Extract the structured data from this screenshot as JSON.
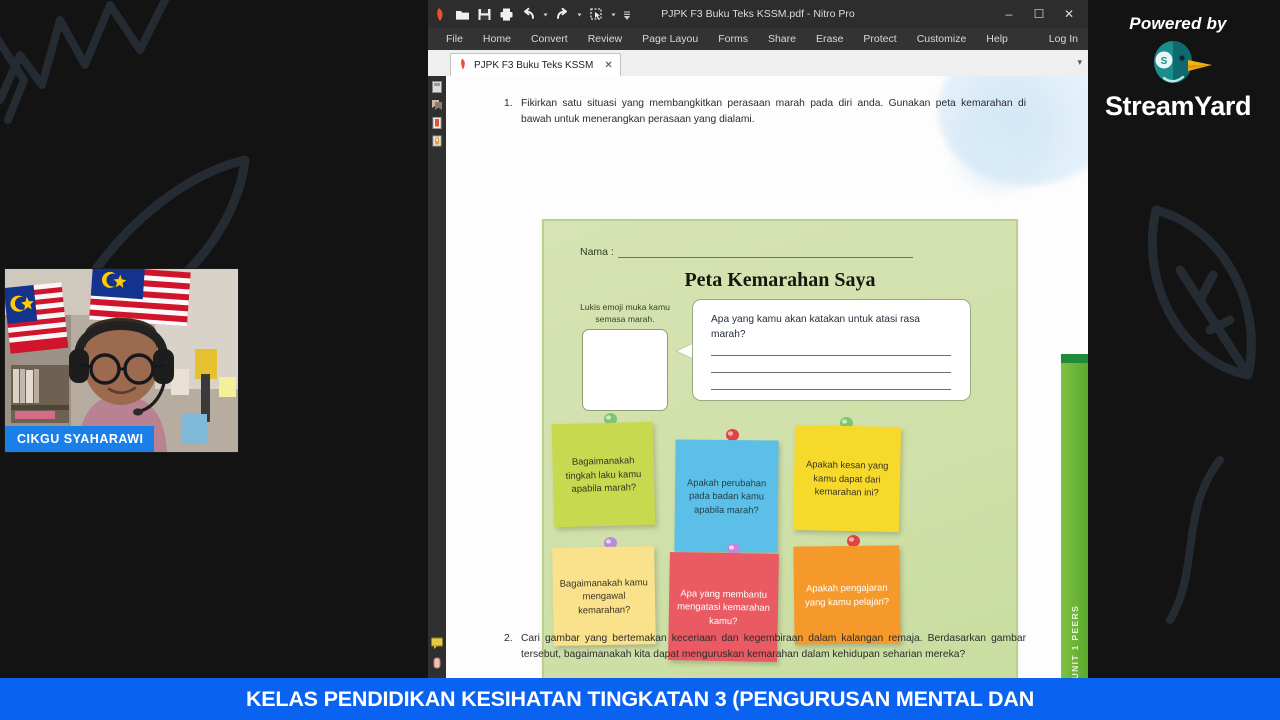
{
  "stream": {
    "watermark": {
      "powered_by": "Powered by",
      "brand": "StreamYard",
      "brand_part1": "Stream",
      "brand_part2": "Yard",
      "duck_badge": "S",
      "colors": {
        "duck_teal": "#1f8f8f",
        "duck_dark": "#0d5f63",
        "beak": "#f5b битые"
      }
    },
    "webcam": {
      "participant_name": "CIKGU SYAHARAWI",
      "name_bg": "#1a7fe8"
    },
    "banner": {
      "text": "KELAS PENDIDIKAN KESIHATAN TINGKATAN 3 (PENGURUSAN MENTAL DAN",
      "background": "#0a62f0",
      "color": "#ffffff"
    },
    "background_color": "#131313"
  },
  "nitro": {
    "window_title": "PJPK F3 Buku Teks KSSM.pdf - Nitro Pro",
    "quick_access": [
      {
        "name": "nitro-logo-icon",
        "glyph": ""
      },
      {
        "name": "open-folder-icon",
        "glyph": ""
      },
      {
        "name": "save-icon",
        "glyph": ""
      },
      {
        "name": "print-icon",
        "glyph": ""
      },
      {
        "name": "undo-icon",
        "glyph": ""
      },
      {
        "name": "undo-dropdown-icon",
        "glyph": ""
      },
      {
        "name": "redo-icon",
        "glyph": ""
      },
      {
        "name": "redo-dropdown-icon",
        "glyph": ""
      },
      {
        "name": "select-tool-icon",
        "glyph": ""
      },
      {
        "name": "select-dropdown-icon",
        "glyph": ""
      },
      {
        "name": "customize-toolbar-icon",
        "glyph": ""
      }
    ],
    "window_controls": {
      "minimize": "–",
      "maximize": "☐",
      "close": "✕"
    },
    "menu": [
      "File",
      "Home",
      "Convert",
      "Review",
      "Page Layou",
      "Forms",
      "Share",
      "Erase",
      "Protect",
      "Customize",
      "Help"
    ],
    "login_label": "Log In",
    "tab": {
      "label": "PJPK F3 Buku Teks KSSM",
      "close": "✕",
      "overflow_caret": "▾"
    },
    "left_rail": [
      "page-thumbnails-icon",
      "bookmarks-icon",
      "annotations-icon",
      "security-lock-icon",
      "comments-icon",
      "sign-icon"
    ]
  },
  "document": {
    "questions": [
      {
        "number": "1.",
        "text": "Fikirkan satu situasi yang membangkitkan perasaan marah pada diri anda. Gunakan peta kemarahan di bawah untuk menerangkan perasaan yang dialami."
      },
      {
        "number": "2.",
        "text": "Cari gambar yang bertemakan keceriaan dan kegembiraan dalam kalangan remaja. Berdasarkan gambar tersebut, bagaimanakah kita dapat menguruskan kemarahan dalam kehidupan seharian mereka?"
      }
    ],
    "card": {
      "name_label": "Nama :",
      "title": "Peta Kemarahan Saya",
      "emoji_caption": "Lukis emoji muka kamu semasa marah.",
      "bubble_question": "Apa yang kamu akan katakan untuk atasi rasa marah?",
      "bubble_answer_lines": 3,
      "background": "#cfe0a8",
      "sticky_notes": [
        {
          "text": "Bagaimanakah tingkah laku kamu apabila marah?",
          "color": "#c2d44a",
          "pin_color": "#6ec26e",
          "row": 1
        },
        {
          "text": "Apakah perubahan pada badan kamu apabila marah?",
          "color": "#57bde8",
          "pin_color": "#e03a3a",
          "row": 1
        },
        {
          "text": "Apakah kesan yang kamu dapat dari kemarahan ini?",
          "color": "#f5d82e",
          "pin_color": "#79c95a",
          "row": 1
        },
        {
          "text": "Bagaimanakah kamu mengawal kemarahan?",
          "color": "#fbe38a",
          "pin_color": "#b38ad6",
          "row": 2
        },
        {
          "text": "Apa yang membantu mengatasi kemarahan kamu?",
          "color": "#ea5a63",
          "pin_color": "#c07ddb",
          "row": 2
        },
        {
          "text": "Apakah pengajaran yang kamu pelajari?",
          "color": "#f59a2a",
          "pin_color": "#e03a3a",
          "row": 2
        }
      ]
    },
    "side_tab": {
      "label": "UNIT 1  PEERS",
      "color": "#6cbb3c"
    },
    "cursor": "hand-cursor"
  }
}
